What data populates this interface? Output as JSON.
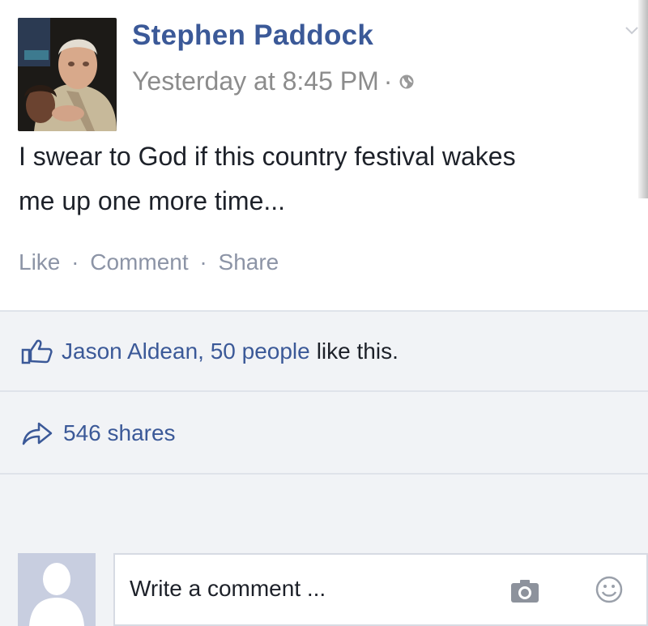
{
  "post": {
    "author": "Stephen Paddock",
    "timestamp": "Yesterday at 8:45 PM",
    "meta_separator": "·",
    "privacy_icon": "globe-icon",
    "text_line1": "I swear to God if this country festival wakes",
    "text_line2": "me up one more time..."
  },
  "actions": {
    "like": "Like",
    "comment": "Comment",
    "share": "Share",
    "separator": "·"
  },
  "likes": {
    "icon": "thumbs-up-icon",
    "names": "Jason Aldean, 50 people",
    "tail": "like this."
  },
  "shares": {
    "icon": "share-arrow-icon",
    "label": "546 shares"
  },
  "comment_box": {
    "placeholder": "Write a comment ...",
    "icons": [
      "camera-icon",
      "smiley-icon"
    ]
  },
  "colors": {
    "link": "#3b5998",
    "muted": "#8c8c8c",
    "panel": "#f1f3f6",
    "text": "#1d2129"
  }
}
